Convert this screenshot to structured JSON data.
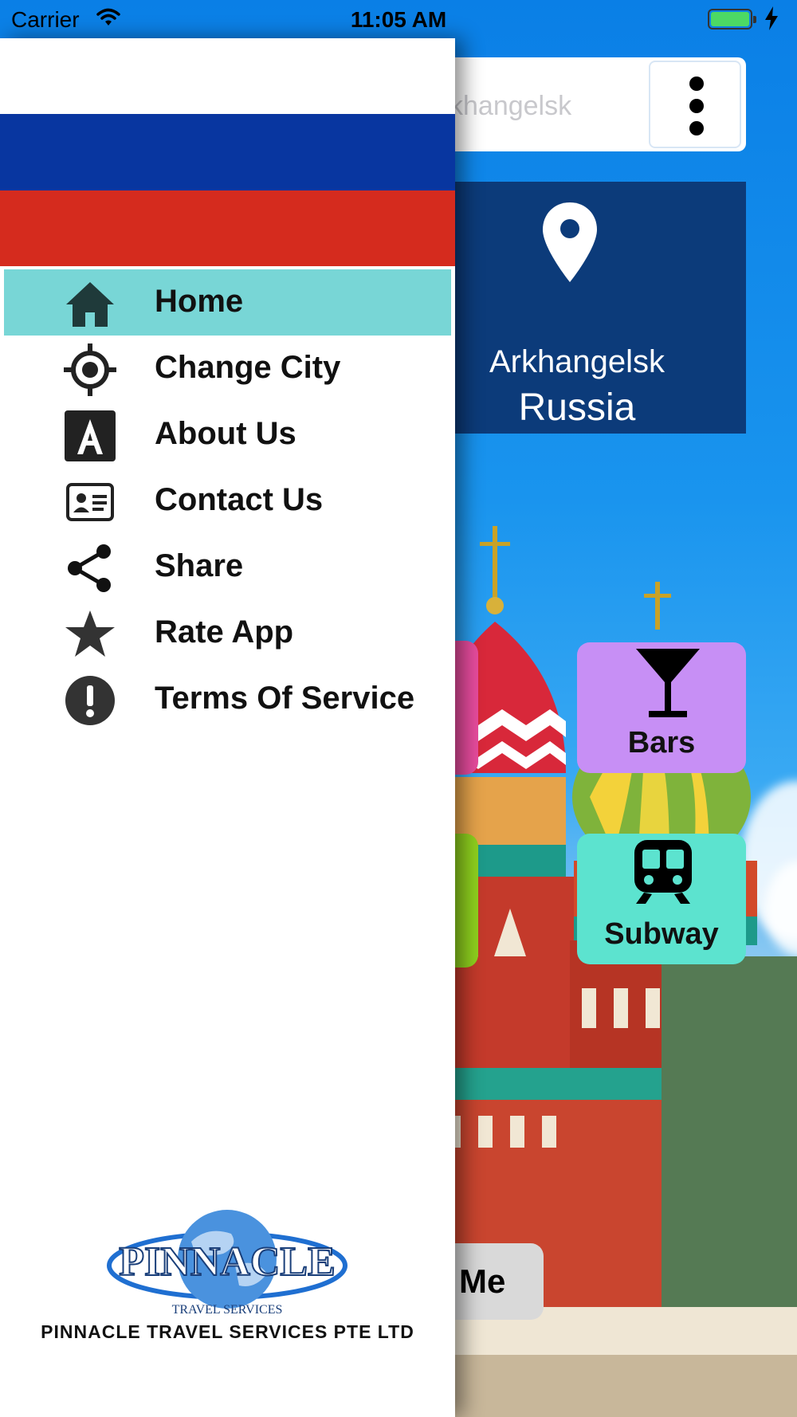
{
  "status_bar": {
    "carrier": "Carrier",
    "time": "11:05 AM"
  },
  "search": {
    "text": "khangelsk"
  },
  "location": {
    "city": "Arkhangelsk",
    "country": "Russia"
  },
  "tiles": {
    "bars": "Bars",
    "subway": "Subway",
    "me_partial": "Me"
  },
  "drawer": {
    "menu": [
      {
        "label": "Home",
        "icon": "home-icon",
        "active": true
      },
      {
        "label": "Change City",
        "icon": "crosshair-icon"
      },
      {
        "label": "About Us",
        "icon": "letter-a-icon"
      },
      {
        "label": "Contact Us",
        "icon": "contact-card-icon"
      },
      {
        "label": "Share",
        "icon": "share-icon"
      },
      {
        "label": "Rate App",
        "icon": "star-icon"
      },
      {
        "label": "Terms Of Service",
        "icon": "exclamation-icon"
      }
    ],
    "logo_text": "PINNACLE",
    "logo_subtext": "TRAVEL SERVICES",
    "company": "PINNACLE TRAVEL SERVICES PTE LTD"
  },
  "colors": {
    "flag_white": "#ffffff",
    "flag_blue": "#0836a0",
    "flag_red": "#d52b1e",
    "active_item": "#78d6d6",
    "location_card": "#0c3b7a",
    "bars_tile": "#c78ff5",
    "subway_tile": "#5ce3cf"
  }
}
